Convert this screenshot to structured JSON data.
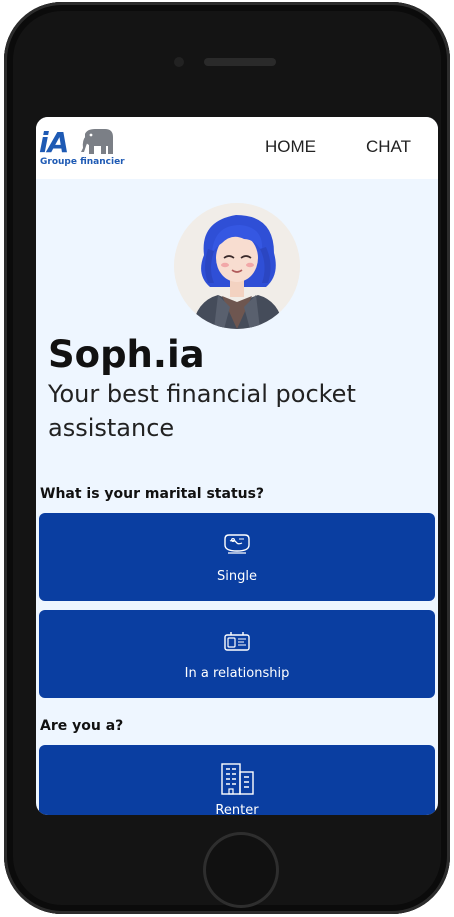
{
  "header": {
    "logo": {
      "brand": "iA",
      "subtitle": "Groupe financier"
    },
    "nav": [
      {
        "label": "HOME"
      },
      {
        "label": "CHAT"
      }
    ]
  },
  "hero": {
    "title": "Soph.ia",
    "subtitle": "Your best financial pocket assistance"
  },
  "marital": {
    "question": "What is your marital status?",
    "options": [
      {
        "label": "Single",
        "icon": "single-icon"
      },
      {
        "label": "In a relationship",
        "icon": "relationship-icon"
      }
    ]
  },
  "housing": {
    "question": "Are you a?",
    "options": [
      {
        "label": "Renter",
        "icon": "building-icon"
      }
    ]
  },
  "colors": {
    "brand_blue": "#1e5ab4",
    "button_blue": "#0a3ea1",
    "page_background": "#eef6ff"
  }
}
